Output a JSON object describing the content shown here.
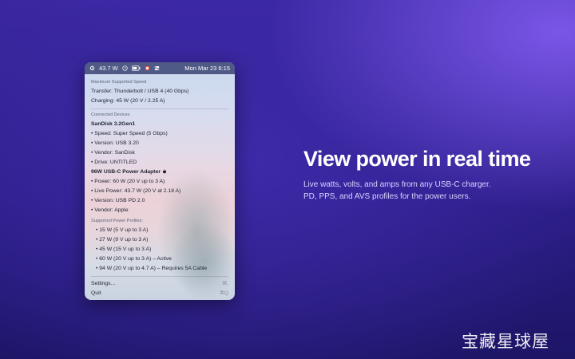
{
  "menubar": {
    "power_reading": "43.7 W",
    "date_time": "Mon Mar 23  6:15",
    "icons": [
      "gear-icon",
      "clock-icon",
      "battery-icon",
      "flag-icon",
      "control-center-icon"
    ]
  },
  "menu": {
    "max_speed": {
      "header": "Maximum Supported Speed",
      "transfer": "Transfer: Thunderbolt / USB 4 (40 Gbps)",
      "charging": "Charging: 45 W (20 V / 2.25 A)"
    },
    "connected": {
      "header": "Connected Devices",
      "device1": {
        "name": "SanDisk 3.2Gen1",
        "speed": "• Speed: Super Speed (5 Gbps)",
        "version": "• Version: USB 3.20",
        "vendor": "• Vendor: SanDisk",
        "drive": "• Drive: UNTITLED"
      },
      "device2": {
        "name": "96W USB-C Power Adapter",
        "power": "• Power: 60 W (20 V up to 3 A)",
        "live_power": "• Live Power: 43.7 W (20 V at 2.18 A)",
        "version": "• Version: USB PD 2.0",
        "vendor": "• Vendor: Apple"
      }
    },
    "profiles": {
      "header": "Supported Power Profiles:",
      "items": [
        "• 15 W (5 V up to 3 A)",
        "• 27 W (9 V up to 3 A)",
        "• 45 W (15 V up to 3 A)",
        "• 60 W (20 V up to 3 A) – Active",
        "• 94 W (20 V up to 4.7 A) – Requires 5A Cable"
      ]
    },
    "settings": {
      "label": "Settings...",
      "shortcut": "⌘,"
    },
    "quit": {
      "label": "Quit",
      "shortcut": "⌘Q"
    }
  },
  "marketing": {
    "headline": "View power in real time",
    "description": "Live watts, volts, and amps from any USB-C charger. PD, PPS, and AVS profiles for the power users."
  },
  "watermark": "宝藏星球屋",
  "colors": {
    "menubar": "#505a86",
    "background_top": "#3a27a0",
    "background_accent": "#7a56e8",
    "text_primary": "#1f2330",
    "headline": "#ffffff"
  }
}
